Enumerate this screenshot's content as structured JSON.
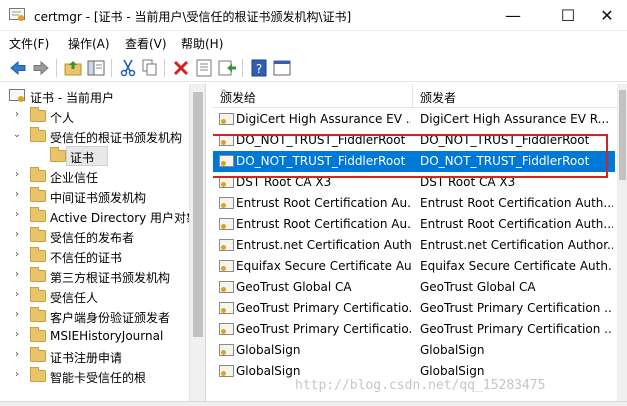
{
  "window": {
    "title": "certmgr - [证书 - 当前用户\\受信任的根证书颁发机构\\证书]",
    "minimize": "—",
    "maximize": "☐",
    "close": "✕"
  },
  "menu": [
    "文件(F)",
    "操作(A)",
    "查看(V)",
    "帮助(H)"
  ],
  "toolbar": [
    "back-arrow-icon",
    "forward-arrow-icon",
    "up-folder-icon",
    "show-hide-tree-icon",
    "cut-icon",
    "copy-icon",
    "delete-icon",
    "properties-icon",
    "export-icon",
    "help-icon",
    "console-icon"
  ],
  "tree": {
    "root": "证书 - 当前用户",
    "items": [
      {
        "label": "个人",
        "expanded": false,
        "indent": 1
      },
      {
        "label": "受信任的根证书颁发机构",
        "expanded": true,
        "indent": 1
      },
      {
        "label": "证书",
        "expanded": null,
        "indent": 2,
        "selected": true
      },
      {
        "label": "企业信任",
        "expanded": false,
        "indent": 1
      },
      {
        "label": "中间证书颁发机构",
        "expanded": false,
        "indent": 1
      },
      {
        "label": "Active Directory 用户对象",
        "expanded": false,
        "indent": 1
      },
      {
        "label": "受信任的发布者",
        "expanded": false,
        "indent": 1
      },
      {
        "label": "不信任的证书",
        "expanded": false,
        "indent": 1
      },
      {
        "label": "第三方根证书颁发机构",
        "expanded": false,
        "indent": 1
      },
      {
        "label": "受信任人",
        "expanded": false,
        "indent": 1
      },
      {
        "label": "客户端身份验证颁发者",
        "expanded": false,
        "indent": 1
      },
      {
        "label": "MSIEHistoryJournal",
        "expanded": false,
        "indent": 1
      },
      {
        "label": "证书注册申请",
        "expanded": false,
        "indent": 1
      },
      {
        "label": "智能卡受信任的根",
        "expanded": false,
        "indent": 1
      }
    ]
  },
  "list": {
    "columns": [
      "颁发给",
      "颁发者"
    ],
    "rows": [
      {
        "issued_to": "DigiCert High Assurance EV ...",
        "issued_by": "DigiCert High Assurance EV R..."
      },
      {
        "issued_to": "DO_NOT_TRUST_FiddlerRoot",
        "issued_by": "DO_NOT_TRUST_FiddlerRoot"
      },
      {
        "issued_to": "DO_NOT_TRUST_FiddlerRoot",
        "issued_by": "DO_NOT_TRUST_FiddlerRoot",
        "selected": true
      },
      {
        "issued_to": "DST Root CA X3",
        "issued_by": "DST Root CA X3"
      },
      {
        "issued_to": "Entrust Root Certification Au...",
        "issued_by": "Entrust Root Certification Auth..."
      },
      {
        "issued_to": "Entrust Root Certification Au...",
        "issued_by": "Entrust Root Certification Auth..."
      },
      {
        "issued_to": "Entrust.net Certification Auth...",
        "issued_by": "Entrust.net Certification Author..."
      },
      {
        "issued_to": "Equifax Secure Certificate Au...",
        "issued_by": "Equifax Secure Certificate Auth..."
      },
      {
        "issued_to": "GeoTrust Global CA",
        "issued_by": "GeoTrust Global CA"
      },
      {
        "issued_to": "GeoTrust Primary Certificatio...",
        "issued_by": "GeoTrust Primary Certification ..."
      },
      {
        "issued_to": "GeoTrust Primary Certificatio...",
        "issued_by": "GeoTrust Primary Certification ..."
      },
      {
        "issued_to": "GlobalSign",
        "issued_by": "GlobalSign"
      },
      {
        "issued_to": "GlobalSign",
        "issued_by": "GlobalSign"
      }
    ]
  },
  "colors": {
    "selection": "#0078d7",
    "highlight_border": "#d0242b",
    "folder": "#e9c46a"
  },
  "watermark": "http://blog.csdn.net/qq_15283475"
}
